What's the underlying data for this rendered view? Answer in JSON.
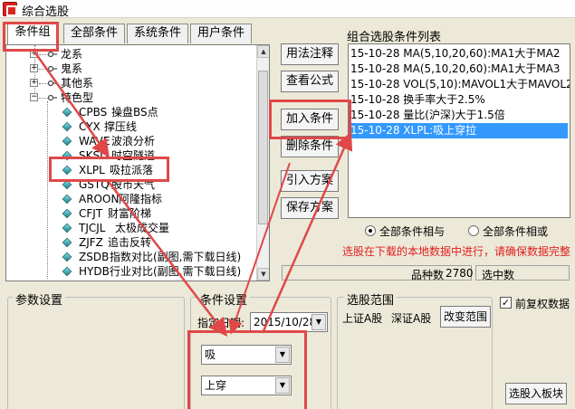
{
  "window": {
    "title": "综合选股"
  },
  "tabs": [
    {
      "label": "条件组",
      "active": true
    },
    {
      "label": "全部条件",
      "active": false
    },
    {
      "label": "系统条件",
      "active": false
    },
    {
      "label": "用户条件",
      "active": false
    }
  ],
  "tree": {
    "groups": [
      {
        "label": "龙系",
        "expander": "+"
      },
      {
        "label": "鬼系",
        "expander": "+"
      },
      {
        "label": "其他系",
        "expander": "+"
      },
      {
        "label": "特色型",
        "expander": "−"
      }
    ],
    "items": [
      {
        "code": "CPBS",
        "name": "操盘BS点"
      },
      {
        "code": "CYX",
        "name": "撑压线"
      },
      {
        "code": "WAVE",
        "name": "波浪分析"
      },
      {
        "code": "SKSD",
        "name": "时空隧道"
      },
      {
        "code": "XLPL",
        "name": "吸拉派落"
      },
      {
        "code": "GSTQ",
        "name": "股市天气"
      },
      {
        "code": "AROON",
        "name": "阿隆指标"
      },
      {
        "code": "CFJT",
        "name": "财富阶梯"
      },
      {
        "code": "TJCJL",
        "name": "太极成交量"
      },
      {
        "code": "ZJFZ",
        "name": "追击反转"
      },
      {
        "code": "ZSDB",
        "name": "指数对比(副图,需下载日线)"
      },
      {
        "code": "HYDB",
        "name": "行业对比(副图,需下载日线)"
      }
    ]
  },
  "buttons": {
    "usage": "用法注释",
    "formula": "查看公式",
    "add": "加入条件",
    "delete": "删除条件",
    "import": "引入方案",
    "save": "保存方案",
    "change_range": "改变范围",
    "select_to_block": "选股入板块"
  },
  "condition_list": {
    "label": "组合选股条件列表",
    "items": [
      "15-10-28 MA(5,10,20,60):MA1大于MA2",
      "15-10-28 MA(5,10,20,60):MA1大于MA3",
      "15-10-28 VOL(5,10):MAVOL1大于MAVOL2",
      "15-10-28 换手率大于2.5%",
      "15-10-28 量比(沪深)大于1.5倍",
      "15-10-28 XLPL:吸上穿拉"
    ],
    "selected_index": 5
  },
  "logic": {
    "and_label": "全部条件相与",
    "or_label": "全部条件相或",
    "selected": "and"
  },
  "warning": "选股在下载的本地数据中进行，请确保数据完整",
  "status": {
    "count_label": "品种数",
    "count_value": "2780",
    "selected_label": "选中数"
  },
  "params": {
    "label": "参数设置"
  },
  "condition_settings": {
    "label": "条件设置",
    "date_label": "指定日期:",
    "date_value": "2015/10/28",
    "select1": "吸",
    "select2": "上穿"
  },
  "range": {
    "label": "选股范围",
    "text1": "上证A股",
    "text2": "深证A股"
  },
  "options": {
    "adjusted_label": "前复权数据",
    "adjusted_checked": true,
    "check_mark": "✓"
  },
  "colors": {
    "highlight": "#e04848",
    "selection": "#3399ff",
    "warning": "#e02020"
  }
}
